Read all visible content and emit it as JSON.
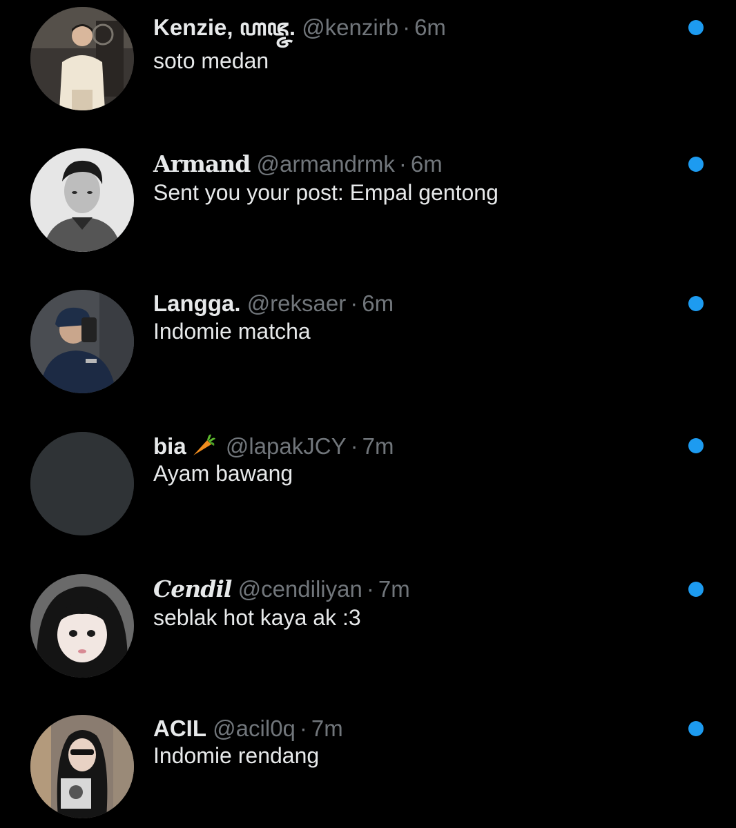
{
  "colors": {
    "background": "#000000",
    "primary_text": "#e7e9ea",
    "secondary_text": "#71767b",
    "unread": "#1d9bf0",
    "avatar_placeholder": "#2f3336"
  },
  "conversations": [
    {
      "display_name": "Kenzie, ꦲꦗ꧀ꦗ.",
      "handle": "@kenzirb",
      "separator": "·",
      "time": "6m",
      "preview": "soto medan",
      "unread": true,
      "avatar_icon": "person-photo-icon"
    },
    {
      "display_name": "Armand",
      "handle": "@armandrmk",
      "separator": "·",
      "time": "6m",
      "preview": "Sent you your post: Empal gentong",
      "unread": true,
      "avatar_icon": "person-photo-icon"
    },
    {
      "display_name": "Langga.",
      "handle": "@reksaer",
      "separator": "·",
      "time": "6m",
      "preview": "Indomie matcha",
      "unread": true,
      "avatar_icon": "person-photo-icon"
    },
    {
      "display_name": "bia",
      "handle": "@lapakJCY",
      "separator": "·",
      "time": "7m",
      "preview": "Ayam bawang",
      "unread": true,
      "avatar_icon": "empty-avatar-icon",
      "name_emoji": "carrot-icon"
    },
    {
      "display_name": "Cendil",
      "handle": "@cendiliyan",
      "separator": "·",
      "time": "7m",
      "preview": "seblak hot kaya ak :3",
      "unread": true,
      "avatar_icon": "person-photo-icon"
    },
    {
      "display_name": "ACIL",
      "handle": "@acil0q",
      "separator": "·",
      "time": "7m",
      "preview": "Indomie rendang",
      "unread": true,
      "avatar_icon": "person-photo-icon"
    }
  ]
}
